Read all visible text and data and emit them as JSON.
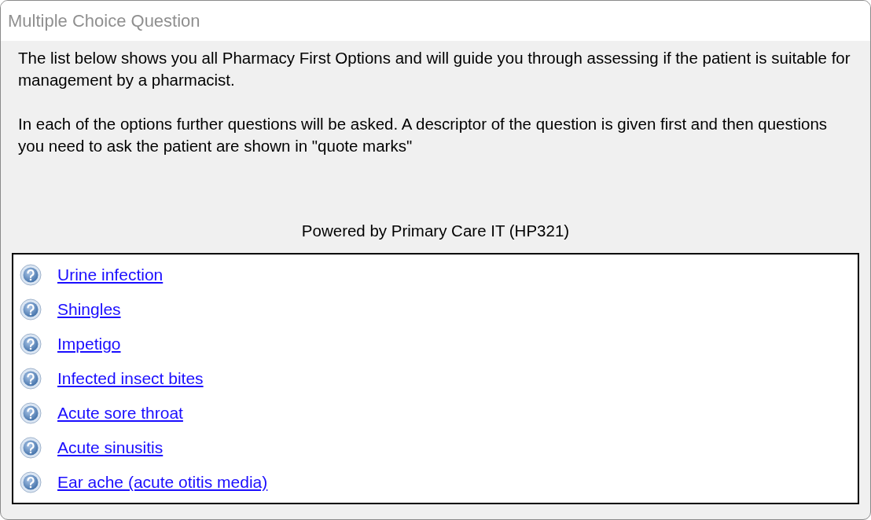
{
  "window": {
    "title": "Multiple Choice Question"
  },
  "intro": [
    "The list below shows you all Pharmacy First Options and will guide you through assessing if the patient is suitable for management by a pharmacist.",
    "In each of the options further questions will be asked.  A descriptor of the question is given first and then questions you need to ask the patient are shown in \"quote marks\""
  ],
  "footer": "Powered by Primary Care IT (HP321)",
  "options": [
    {
      "label": "Urine infection"
    },
    {
      "label": "Shingles"
    },
    {
      "label": "Impetigo"
    },
    {
      "label": "Infected insect bites"
    },
    {
      "label": "Acute sore throat"
    },
    {
      "label": "Acute sinusitis"
    },
    {
      "label": "Ear ache (acute otitis media)"
    }
  ]
}
